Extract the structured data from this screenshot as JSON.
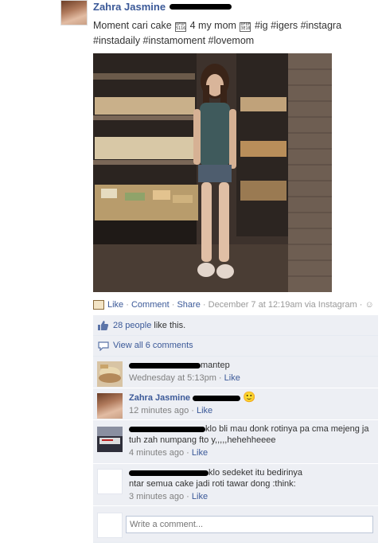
{
  "post": {
    "author": "Zahra Jasmine",
    "text_line1_a": "Moment cari cake",
    "text_line1_b": "4 my mom",
    "text_line1_c": "#ig #igers #instagra",
    "text_line2": "#instadaily #instamoment #lovemom",
    "glyph1_top": "0F0F",
    "glyph1_bot": "5116",
    "glyph2_top": "0F0F",
    "glyph2_bot": "3E10"
  },
  "actions": {
    "like": "Like",
    "comment": "Comment",
    "share": "Share",
    "timestamp": "December 7 at 12:19am via Instagram",
    "sep": "·"
  },
  "likes": {
    "count_link": "28 people",
    "suffix": " like this."
  },
  "view_all": "View all 6 comments",
  "comments": [
    {
      "name": "",
      "text": "mantep",
      "time": "Wednesday at 5:13pm",
      "like": "Like"
    },
    {
      "name": "Zahra Jasmine",
      "text": "",
      "time": "12 minutes ago",
      "like": "Like",
      "emoticon": "🙂"
    },
    {
      "name": "",
      "text_line1": "klo bli mau donk rotinya pa cma mejeng ja",
      "text_line2": "tuh zah numpang fto y,,,,,hehehheeee",
      "time": "4 minutes ago",
      "like": "Like"
    },
    {
      "name": "",
      "text_line1": "klo sedeket itu bedirinya",
      "text_line2": "ntar semua cake jadi roti tawar dong :think:",
      "time": "3 minutes ago",
      "like": "Like"
    }
  ],
  "write_comment": {
    "placeholder": "Write a comment..."
  },
  "colors": {
    "link": "#3b5998",
    "ufi_bg": "#edeff4",
    "meta": "#808080"
  }
}
